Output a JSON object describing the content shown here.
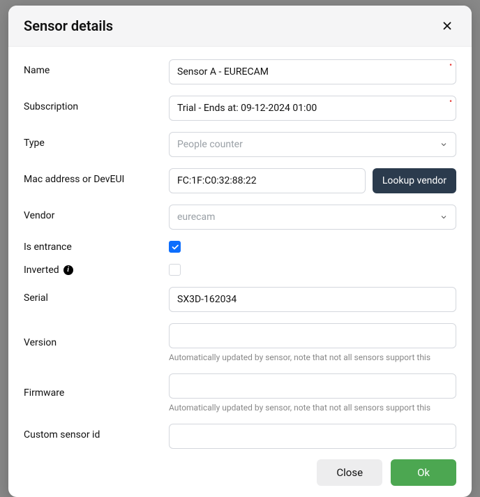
{
  "modal": {
    "title": "Sensor details"
  },
  "labels": {
    "name": "Name",
    "subscription": "Subscription",
    "type": "Type",
    "mac": "Mac address or DevEUI",
    "vendor": "Vendor",
    "isEntrance": "Is entrance",
    "inverted": "Inverted",
    "serial": "Serial",
    "version": "Version",
    "firmware": "Firmware",
    "customId": "Custom sensor id"
  },
  "values": {
    "name": "Sensor A - EURECAM",
    "subscription": "Trial - Ends at: 09-12-2024 01:00",
    "type": "People counter",
    "mac": "FC:1F:C0:32:88:22",
    "vendor": "eurecam",
    "serial": "SX3D-162034",
    "version": "",
    "firmware": "",
    "customId": ""
  },
  "help": {
    "autoUpdate": "Automatically updated by sensor, note that not all sensors support this"
  },
  "buttons": {
    "lookupVendor": "Lookup vendor",
    "close": "Close",
    "ok": "Ok"
  },
  "colors": {
    "primary": "#4ca751",
    "accent": "#0d6efd",
    "dark": "#2b3b4d"
  }
}
